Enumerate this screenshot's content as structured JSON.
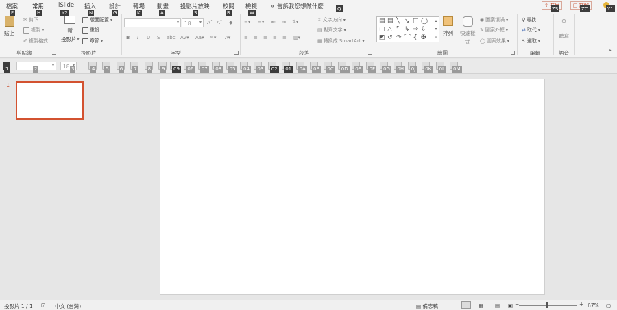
{
  "tabs": [
    "檔案",
    "常用",
    "iSlide",
    "插入",
    "設計",
    "轉場",
    "動畫",
    "投影片放映",
    "校閱",
    "檢視"
  ],
  "active_tab": "常用",
  "tell_me": "告訴我您想做什麼",
  "top_right": {
    "share": "共用",
    "comments": "註解"
  },
  "keytips": {
    "file": "F",
    "home": "H",
    "islide": "Y2",
    "insert": "N",
    "design": "G",
    "transitions": "K",
    "animations": "A",
    "slideshow": "S",
    "review": "R",
    "view": "W",
    "tellme": "Q",
    "share": "ZS",
    "comments": "ZC",
    "account": "Y1"
  },
  "ribbon": {
    "clipboard": {
      "label": "剪貼簿",
      "paste": "貼上",
      "cut": "剪下",
      "copy": "複製",
      "format_painter": "複製格式"
    },
    "slides": {
      "label": "投影片",
      "new_slide_1": "新",
      "new_slide_2": "投影片",
      "layout": "版面配置",
      "reset": "重設",
      "section": "章節"
    },
    "font": {
      "label": "字型",
      "font_name": "",
      "font_size": "18"
    },
    "paragraph": {
      "label": "段落",
      "text_direction": "文字方向",
      "align_text": "對齊文字",
      "smartart": "轉換成 SmartArt"
    },
    "drawing": {
      "label": "繪圖",
      "arrange": "排列",
      "quick_styles_1": "快速樣",
      "quick_styles_2": "式",
      "fill": "圖案填滿",
      "outline": "圖案外框",
      "effects": "圖案效果"
    },
    "editing": {
      "label": "編輯",
      "find": "尋找",
      "replace": "取代",
      "select": "選取"
    },
    "voice": {
      "label": "語音",
      "dictate": "聽寫"
    }
  },
  "strip": {
    "font_size": "18",
    "keytips": [
      "1",
      "2",
      "3",
      "4",
      "5",
      "6",
      "7",
      "8",
      "9",
      "09",
      "06",
      "07",
      "08",
      "05",
      "04",
      "03",
      "02",
      "01",
      "0A",
      "0B",
      "0C",
      "0D",
      "0E",
      "0F",
      "0G",
      "0H",
      "0J",
      "0K",
      "0L",
      "0M"
    ]
  },
  "thumbs": {
    "num": "1"
  },
  "status": {
    "slide_count": "投影片 1 / 1",
    "language": "中文 (台灣)",
    "notes": "備忘稿",
    "zoom": "67%",
    "minus": "−",
    "plus": "+"
  }
}
